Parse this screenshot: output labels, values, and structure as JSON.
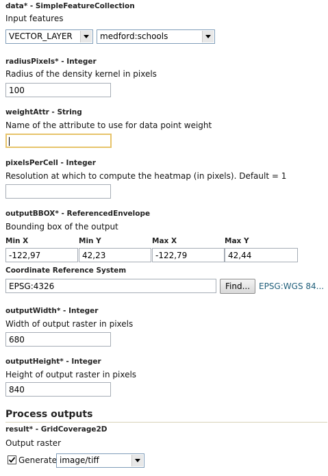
{
  "data_param": {
    "label": "data* - SimpleFeatureCollection",
    "description": "Input features",
    "type_select": "VECTOR_LAYER",
    "layer_select": "medford:schools"
  },
  "radius_param": {
    "label": "radiusPixels* - Integer",
    "description": "Radius of the density kernel in pixels",
    "value": "100"
  },
  "weight_param": {
    "label": "weightAttr - String",
    "description": "Name of the attribute to use for data point weight",
    "value": ""
  },
  "pixels_param": {
    "label": "pixelsPerCell - Integer",
    "description": "Resolution at which to compute the heatmap (in pixels). Default = 1",
    "value": ""
  },
  "bbox_param": {
    "label": "outputBBOX* - ReferencedEnvelope",
    "description": "Bounding box of the output",
    "columns": [
      {
        "header": "Min X",
        "value": "-122,97"
      },
      {
        "header": "Min Y",
        "value": "42,23"
      },
      {
        "header": "Max X",
        "value": "-122,79"
      },
      {
        "header": "Max Y",
        "value": "42,44"
      }
    ],
    "crs_label": "Coordinate Reference System",
    "crs_value": "EPSG:4326",
    "find_button": "Find...",
    "crs_link": "EPSG:WGS 84..."
  },
  "width_param": {
    "label": "outputWidth* - Integer",
    "description": "Width of output raster in pixels",
    "value": "680"
  },
  "height_param": {
    "label": "outputHeight* - Integer",
    "description": "Height of output raster in pixels",
    "value": "840"
  },
  "outputs": {
    "title": "Process outputs",
    "result_label": "result* - GridCoverage2D",
    "result_description": "Output raster",
    "generate_checked": true,
    "generate_label": "Generate",
    "format_select": "image/tiff"
  },
  "colors": {
    "focus_border": "#e6c36a",
    "link": "#1f5e7a",
    "divider": "#d8d2b8"
  }
}
